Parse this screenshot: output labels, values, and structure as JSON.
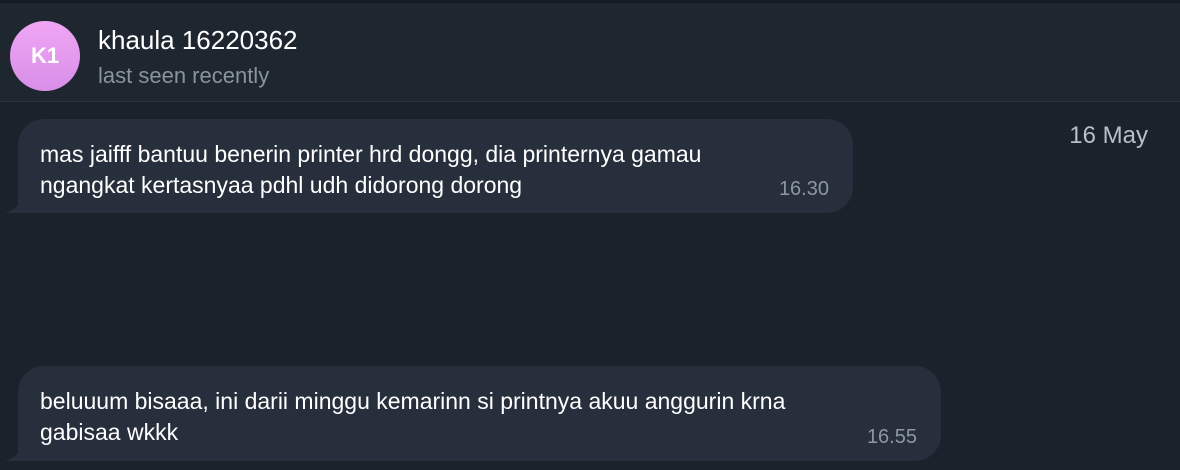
{
  "header": {
    "avatar_initials": "K1",
    "contact_name": "khaula 16220362",
    "status": "last seen recently"
  },
  "chat": {
    "date_label": "16 May",
    "messages": [
      {
        "lines": [
          "mas jaifff bantuu benerin printer hrd dongg, dia printernya gamau",
          "ngangkat kertasnyaa pdhl udh didorong dorong"
        ],
        "time": "16.30"
      },
      {
        "lines": [
          "beluuum bisaaa, ini darii minggu kemarinn si printnya akuu anggurin krna",
          "gabisaa wkkk"
        ],
        "time": "16.55"
      }
    ]
  },
  "colors": {
    "background": "#1b222c",
    "header_background": "#1e2630",
    "bubble": "#262f3b",
    "avatar_gradient_start": "#f0a6f4",
    "avatar_gradient_end": "#d98ee8",
    "secondary_text": "#8a949e"
  }
}
